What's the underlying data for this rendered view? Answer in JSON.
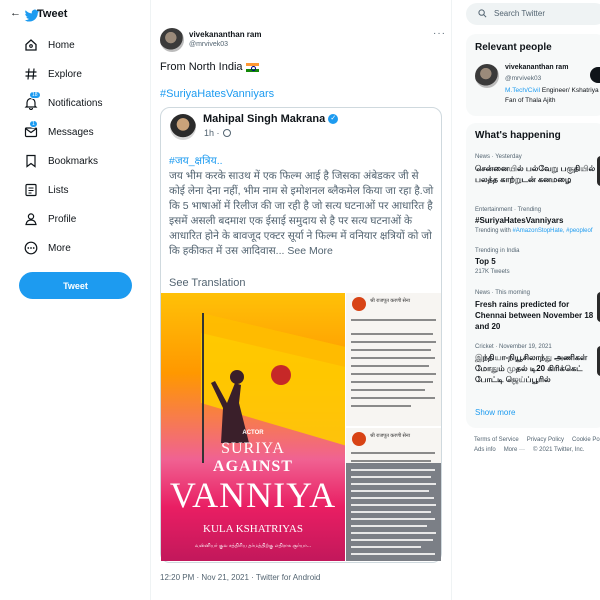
{
  "nav": {
    "items": [
      {
        "label": "Home",
        "icon": "home-icon"
      },
      {
        "label": "Explore",
        "icon": "hashtag-icon"
      },
      {
        "label": "Notifications",
        "icon": "bell-icon",
        "badge": "18"
      },
      {
        "label": "Messages",
        "icon": "mail-icon",
        "badge": "1"
      },
      {
        "label": "Bookmarks",
        "icon": "bookmark-icon"
      },
      {
        "label": "Lists",
        "icon": "list-icon"
      },
      {
        "label": "Profile",
        "icon": "person-icon"
      },
      {
        "label": "More",
        "icon": "more-circle-icon"
      }
    ],
    "tweet_button": "Tweet"
  },
  "header": {
    "title": "Tweet"
  },
  "tweet": {
    "author_name": "vivekananthan ram",
    "author_handle": "@mrvivek03",
    "text": "From North India",
    "hashtag": "#SuriyaHatesVanniyars",
    "meta": "12:20 PM · Nov 21, 2021 · Twitter for Android"
  },
  "quoted": {
    "author_name": "Mahipal Singh Makrana",
    "time": "1h ·",
    "hashtag": "#जय_क्षत्रिय..",
    "body": " जय भीम करके साउथ में एक फिल्म आई है जिसका अंबेडकर जी से कोई लेना देना नहीं, भीम नाम से इमोशनल ब्लैकमेल किया जा रहा है.जो कि 5 भाषाओं में रिलीज की जा रही है जो सत्य घटनाओं पर आधारित है इसमें असली बदमाश एक ईसाई समुदाय से है पर सत्य घटनाओं के आधारित होने के बावजूद एक्टर सूर्या ने फिल्म में वनियार क्षत्रियों को जो कि हकीकत में उस आदिवास...",
    "see_more": "See More",
    "see_translation": "See Translation",
    "poster": {
      "actor": "ACTOR",
      "line1": "SURIYA",
      "line2": "AGAINST",
      "line3": "VANNIYA",
      "line4": "KULA KSHATRIYAS",
      "line5": "வன்னியர் குல சத்திரிய தர்மத்திற்கு எதிராக சூர்யா..."
    },
    "doc_header": "श्री राजपूत करणी सेना"
  },
  "right": {
    "search_placeholder": "Search Twitter",
    "relevant_title": "Relevant people",
    "person": {
      "name": "vivekananthan ram",
      "handle": "@mrvivek03",
      "bio_link": "M.Tech/Civil",
      "bio_rest": " Engineer/ Kshatriya Fan of Thala Ajith"
    },
    "happening_title": "What's happening",
    "trends": [
      {
        "context": "News · Yesterday",
        "title": "சென்னையில் பல்வேறு பகுதியில் பலத்த காற்றுடன் கனமழை",
        "sub": ""
      },
      {
        "context": "Entertainment · Trending",
        "title": "#SuriyaHatesVanniyars",
        "sub_prefix": "Trending with ",
        "sub_link": "#AmazonStopHate, #peopleof"
      },
      {
        "context": "Trending in India",
        "title": "Top 5",
        "sub": "217K Tweets"
      },
      {
        "context": "News · This morning",
        "title": "Fresh rains predicted for Chennai between November 18 and 20",
        "sub": ""
      },
      {
        "context": "Cricket · November 19, 2021",
        "title": "இந்தியா-நியூசிலாந்து அணிகள் மோதும் முதல் டி20 கிரிக்கெட் போட்டி ஜெய்ப்பூரில்",
        "sub": ""
      }
    ],
    "show_more": "Show more",
    "footer_row1": [
      "Terms of Service",
      "Privacy Policy",
      "Cookie Po"
    ],
    "footer_row2": [
      "Ads info",
      "More ···",
      "© 2021 Twitter, Inc."
    ]
  },
  "colors": {
    "accent": "#1d9bf0",
    "text": "#0f1419",
    "muted": "#536471"
  }
}
